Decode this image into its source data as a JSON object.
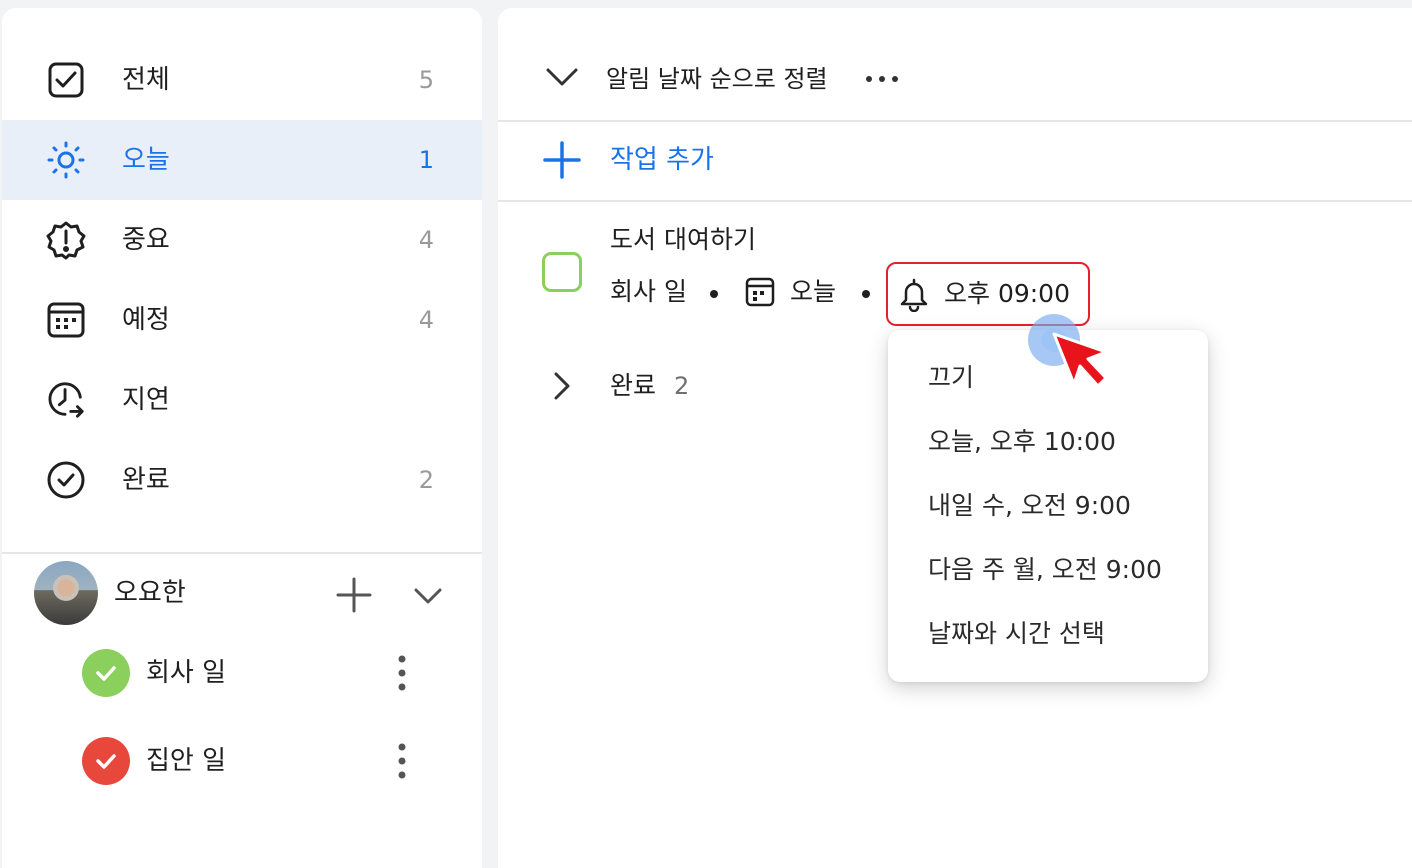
{
  "sidebar": {
    "nav": [
      {
        "label": "전체",
        "count": "5",
        "icon": "checkbox-icon"
      },
      {
        "label": "오늘",
        "count": "1",
        "icon": "sun-icon",
        "active": true
      },
      {
        "label": "중요",
        "count": "4",
        "icon": "important-badge-icon"
      },
      {
        "label": "예정",
        "count": "4",
        "icon": "calendar-icon"
      },
      {
        "label": "지연",
        "count": "",
        "icon": "overdue-clock-icon"
      },
      {
        "label": "완료",
        "count": "2",
        "icon": "check-circle-icon"
      }
    ],
    "account": {
      "name": "오요한"
    },
    "lists": [
      {
        "label": "회사 일",
        "color": "#8bcf5d"
      },
      {
        "label": "집안 일",
        "color": "#e8473b"
      }
    ]
  },
  "main": {
    "sort_label": "알림 날짜 순으로 정렬",
    "add_task_label": "작업 추가",
    "task": {
      "title": "도서 대여하기",
      "list": "회사 일",
      "due": "오늘",
      "reminder": "오후 09:00"
    },
    "completed": {
      "label": "완료",
      "count": "2"
    }
  },
  "reminder_menu": {
    "items": [
      "끄기",
      "오늘, 오후 10:00",
      "내일 수, 오전 9:00",
      "다음 주 월, 오전 9:00",
      "날짜와 시간 선택"
    ]
  },
  "colors": {
    "accent": "#1a73e8",
    "active_bg": "#e8eff9",
    "highlight_box": "#e5202a"
  }
}
